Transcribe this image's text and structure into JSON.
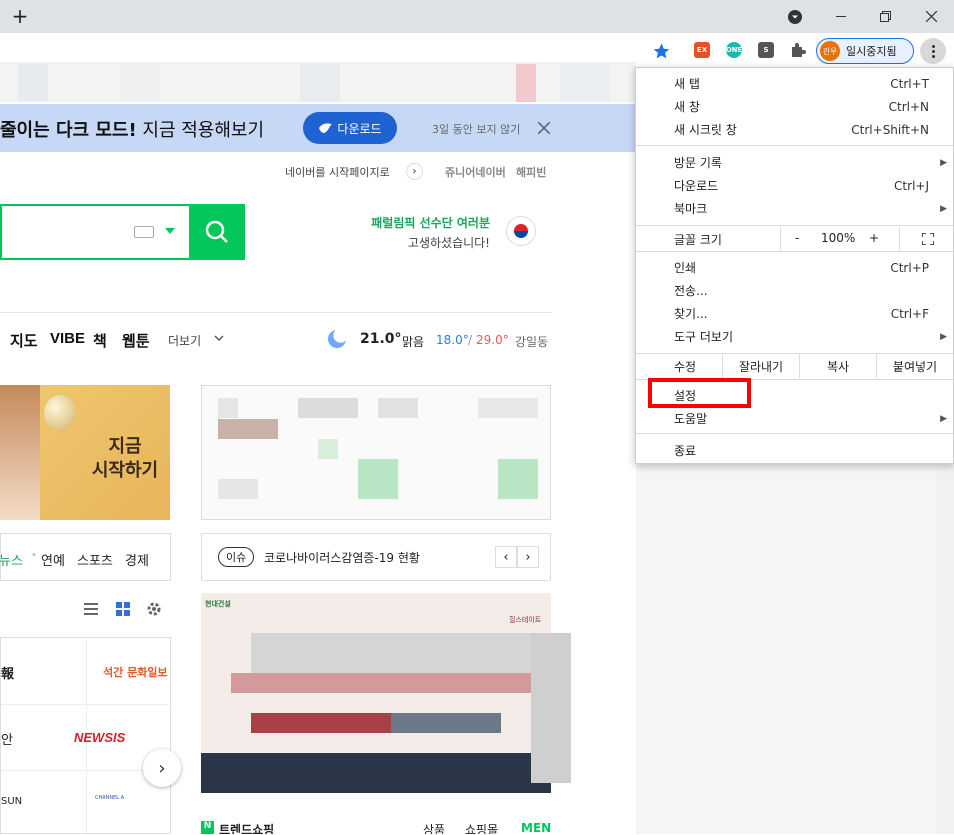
{
  "browser": {
    "new_tab_symbol": "+",
    "profile_name": "일시중지됨",
    "profile_initials": "관우",
    "extensions": [
      {
        "label": "EX",
        "color": "#e8502c"
      },
      {
        "label": "ONE",
        "color": "#1bb8b0"
      },
      {
        "label": "S",
        "color": "#555555"
      }
    ],
    "colors": {
      "titlebar": "#dee1e6",
      "accent": "#1a73e8"
    }
  },
  "page": {
    "dark_mode_text_bold": "줄이는 다크 모드!",
    "dark_mode_text_rest": " 지금 적용해보기",
    "download_label": "다운로드",
    "dismiss_label": "3일 동안 보지 않기",
    "set_homepage": "네이버를 시작페이지로",
    "junior_naver": "쥬니어네이버",
    "happybean": "해피빈",
    "paralympic_line1": "패럴림픽 선수단 여러분",
    "paralympic_line2": "고생하셨습니다!",
    "nav": [
      "지도",
      "VIBE",
      "책",
      "웹툰"
    ],
    "more_label": "더보기",
    "weather_temp": "21.0°",
    "weather_cond": "맑음",
    "weather_low": "18.0°",
    "weather_high": "29.0°",
    "weather_loc": "강일동",
    "ad_text_1": "지금",
    "ad_text_2": "시작하기",
    "news_tabs": [
      "뉴스",
      "연예",
      "스포츠",
      "경제"
    ],
    "issue_badge": "이슈",
    "issue_text": "코로나바이러스감염증-19 현황",
    "press": [
      "석간 문화일보",
      "NEWSIS",
      "CHANNEL A",
      "SUN",
      "안",
      "報"
    ],
    "hillstate_brand": "현대건설",
    "hillstate_logo": "힐스테이트",
    "trend_label": "트렌드쇼핑",
    "trend_tabs": [
      "상품",
      "쇼핑몰",
      "MEN"
    ],
    "colors": {
      "naver_green": "#03c75a",
      "banner_bg": "#c6d8f5"
    }
  },
  "menu": {
    "new_tab": "새 탭",
    "new_tab_sc": "Ctrl+T",
    "new_window": "새 창",
    "new_window_sc": "Ctrl+N",
    "incognito": "새 시크릿 창",
    "incognito_sc": "Ctrl+Shift+N",
    "history": "방문 기록",
    "downloads": "다운로드",
    "downloads_sc": "Ctrl+J",
    "bookmarks": "북마크",
    "zoom_label": "글꼴 크기",
    "zoom_minus": "-",
    "zoom_value": "100%",
    "zoom_plus": "+",
    "print": "인쇄",
    "print_sc": "Ctrl+P",
    "cast": "전송...",
    "find": "찾기...",
    "find_sc": "Ctrl+F",
    "more_tools": "도구 더보기",
    "edit": "수정",
    "cut": "잘라내기",
    "copy": "복사",
    "paste": "붙여넣기",
    "settings": "설정",
    "help": "도움말",
    "exit": "종료",
    "highlight_color": "#ff0000"
  }
}
